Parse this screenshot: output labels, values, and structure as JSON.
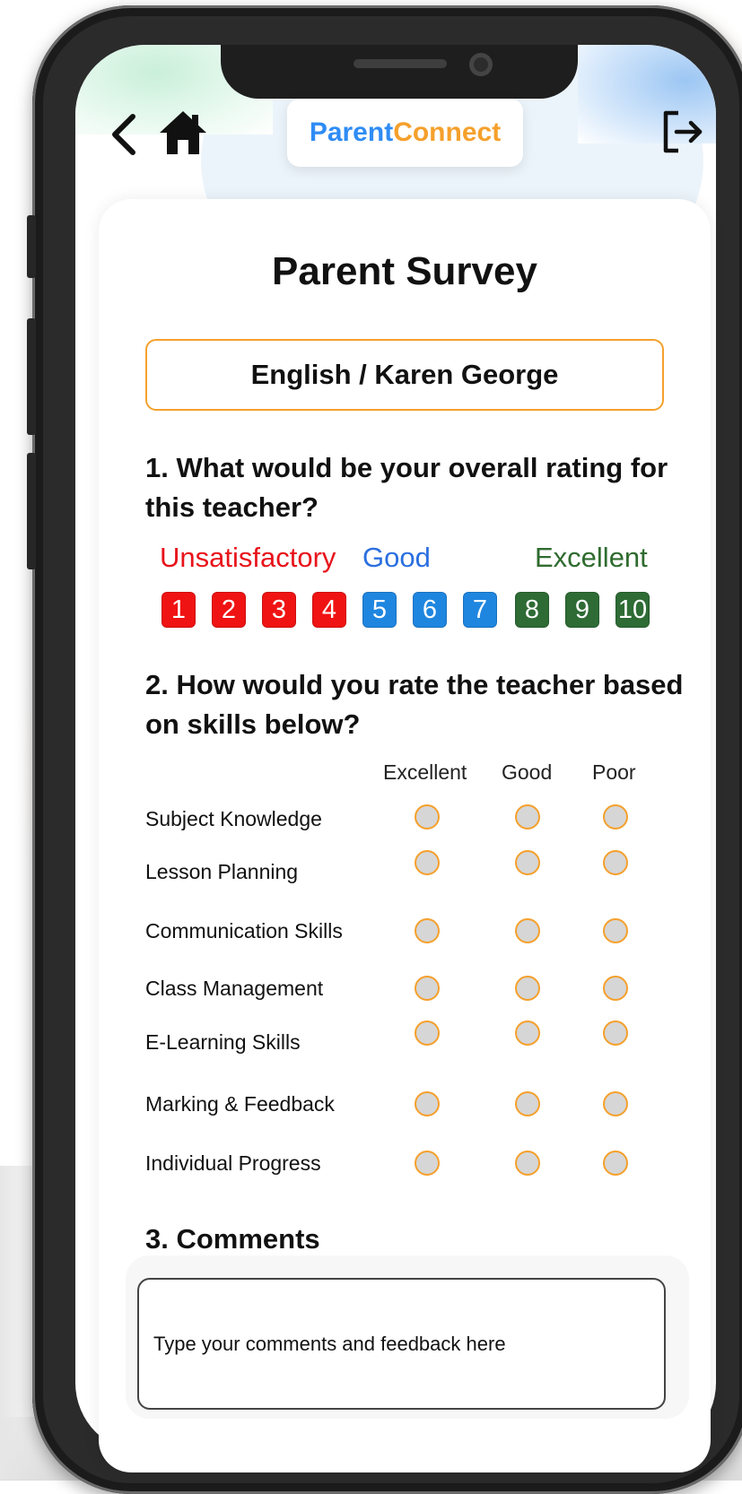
{
  "app": {
    "brand_part1": "Parent",
    "brand_part2": "Connect",
    "colors": {
      "brand_blue": "#2f8cf5",
      "brand_orange": "#f5a02c"
    }
  },
  "nav": {
    "back_icon": "chevron-left-icon",
    "home_icon": "home-icon",
    "logout_icon": "logout-icon"
  },
  "survey": {
    "title": "Parent Survey",
    "subject": "English / Karen George",
    "q1": {
      "text": "1. What would be your overall rating for this teacher?",
      "labels": {
        "unsatisfactory": "Unsatisfactory",
        "good": "Good",
        "excellent": "Excellent"
      },
      "scale": [
        {
          "value": "1",
          "color": "#f01313"
        },
        {
          "value": "2",
          "color": "#f01313"
        },
        {
          "value": "3",
          "color": "#f01313"
        },
        {
          "value": "4",
          "color": "#f01313"
        },
        {
          "value": "5",
          "color": "#1f86e0"
        },
        {
          "value": "6",
          "color": "#1f86e0"
        },
        {
          "value": "7",
          "color": "#1f86e0"
        },
        {
          "value": "8",
          "color": "#2e6b35"
        },
        {
          "value": "9",
          "color": "#2e6b35"
        },
        {
          "value": "10",
          "color": "#2e6b35"
        }
      ]
    },
    "q2": {
      "text": "2. How would you rate the teacher based on skills below?",
      "columns": [
        "Excellent",
        "Good",
        "Poor"
      ],
      "skills": [
        "Subject Knowledge",
        "Lesson Planning",
        "Communication Skills",
        "Class Management",
        "E-Learning Skills",
        "Marking & Feedback",
        "Individual Progress"
      ]
    },
    "q3": {
      "text": "3. Comments",
      "placeholder": "Type your comments and feedback here"
    }
  }
}
